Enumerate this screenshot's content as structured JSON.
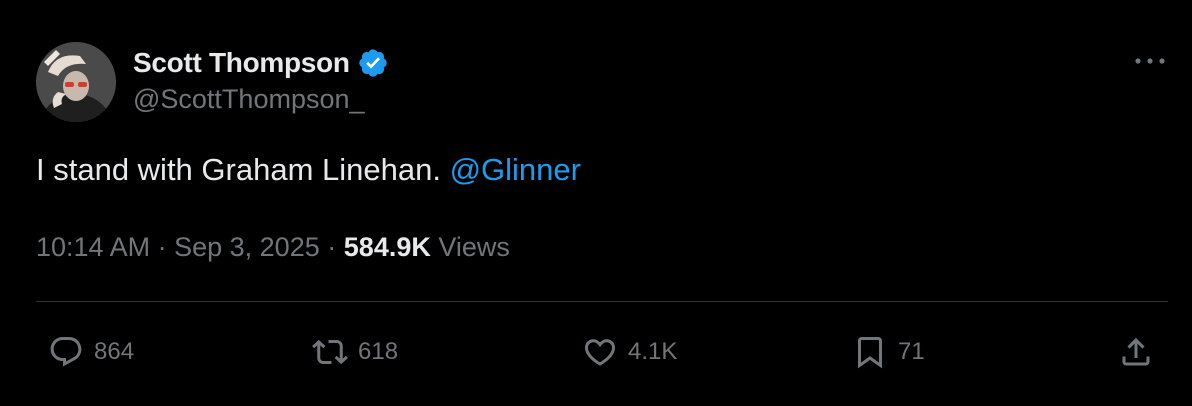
{
  "author": {
    "display_name": "Scott Thompson",
    "handle": "@ScottThompson_",
    "verified": true,
    "verified_color": "#1d9bf0"
  },
  "tweet": {
    "text": "I stand with Graham Linehan.",
    "mention": "@Glinner",
    "mention_color": "#1d9bf0"
  },
  "meta": {
    "time": "10:14 AM",
    "separator": "·",
    "date": "Sep 3, 2025",
    "views_count": "584.9K",
    "views_label": "Views"
  },
  "actions": {
    "reply_count": "864",
    "repost_count": "618",
    "like_count": "4.1K",
    "bookmark_count": "71"
  },
  "icons": {
    "more": "more-horizontal-icon",
    "reply": "reply-bubble-icon",
    "repost": "repost-arrows-icon",
    "like": "heart-icon",
    "bookmark": "bookmark-icon",
    "share": "share-upload-icon"
  },
  "colors": {
    "background": "#000000",
    "primary_text": "#e7e9ea",
    "secondary_text": "#71767b",
    "divider": "#2f3336"
  }
}
